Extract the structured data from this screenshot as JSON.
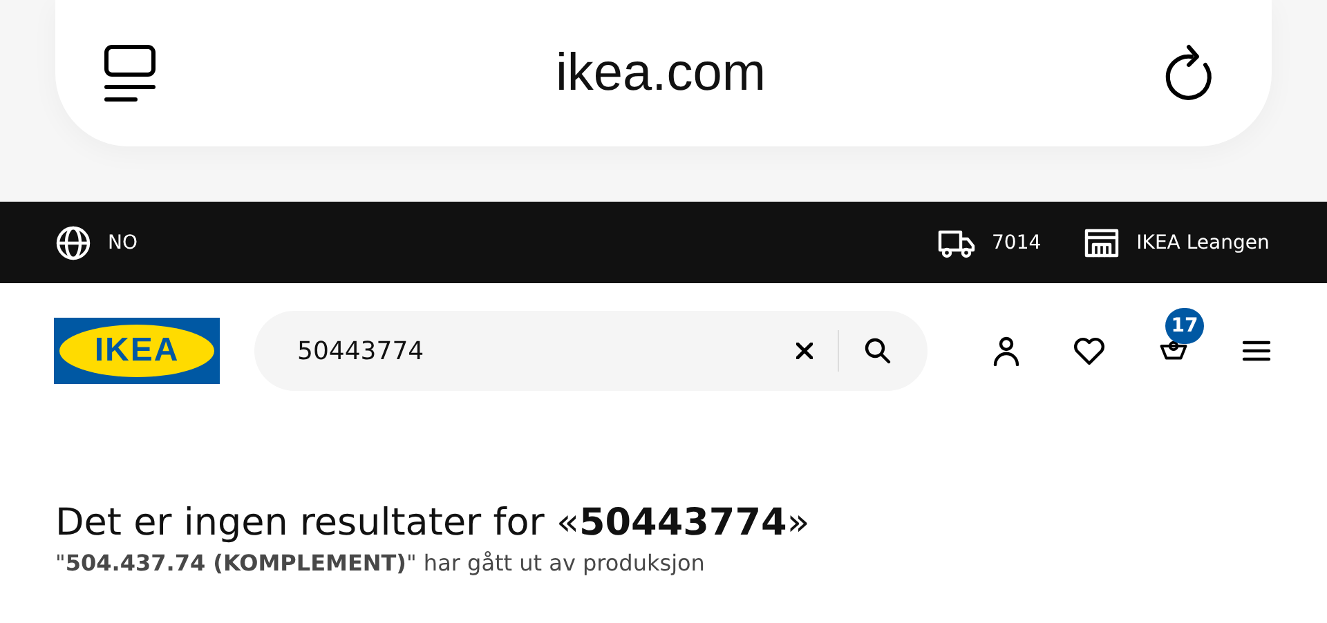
{
  "browser": {
    "address": "ikea.com"
  },
  "top_bar": {
    "language": "NO",
    "postcode": "7014",
    "store": "IKEA Leangen"
  },
  "header": {
    "logo": "IKEA",
    "search": {
      "value": "50443774"
    },
    "cart_count": "17"
  },
  "result": {
    "heading": "Det er ingen resultater for «**50443774**»",
    "message": "\"**504.437.74 (KOMPLEMENT)**\" har gått ut av produksjon"
  }
}
